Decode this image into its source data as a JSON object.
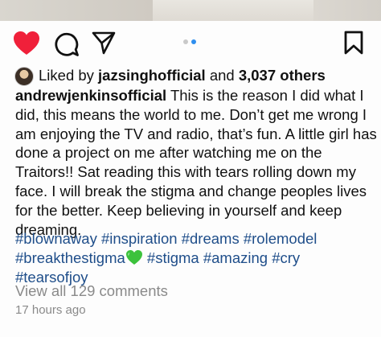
{
  "post": {
    "carousel": {
      "total": 2,
      "active_index": 2
    },
    "likes": {
      "prefix": "Liked by",
      "user": "jazsinghofficial",
      "connector": "and",
      "count": "3,037 others"
    },
    "caption": {
      "author": "andrewjenkinsofficial",
      "lines": [
        " This is the reason I did what I",
        "did, this means the world to me. Don’t get me wrong I",
        "am enjoying the TV and radio, that’s fun. A little girl has",
        "done a project on me after watching me on the",
        "Traitors!! Sat reading this with tears rolling down my",
        "face. I will break the stigma and change peoples lives",
        "for the better. Keep believing in yourself and keep",
        "dreaming."
      ]
    },
    "hashtags": {
      "line1": [
        "#blownaway",
        "#inspiration",
        "#dreams",
        "#rolemodel"
      ],
      "line2_before_emoji": "#breakthestigma",
      "line2_after_emoji": [
        "#stigma",
        "#amazing",
        "#cry"
      ],
      "line3": [
        "#tearsofjoy"
      ]
    },
    "view_comments": "View all 129 comments",
    "timestamp": "17 hours ago"
  },
  "icons": {
    "like": "heart-filled-icon",
    "comment": "comment-bubble-icon",
    "share": "paper-plane-icon",
    "save": "bookmark-icon",
    "emoji": "green-heart-emoji"
  },
  "colors": {
    "like_red": "#f0203a",
    "hashtag_blue": "#1f4e8a",
    "dot_active": "#2f8fef",
    "secondary_text": "#8a8a8a"
  }
}
